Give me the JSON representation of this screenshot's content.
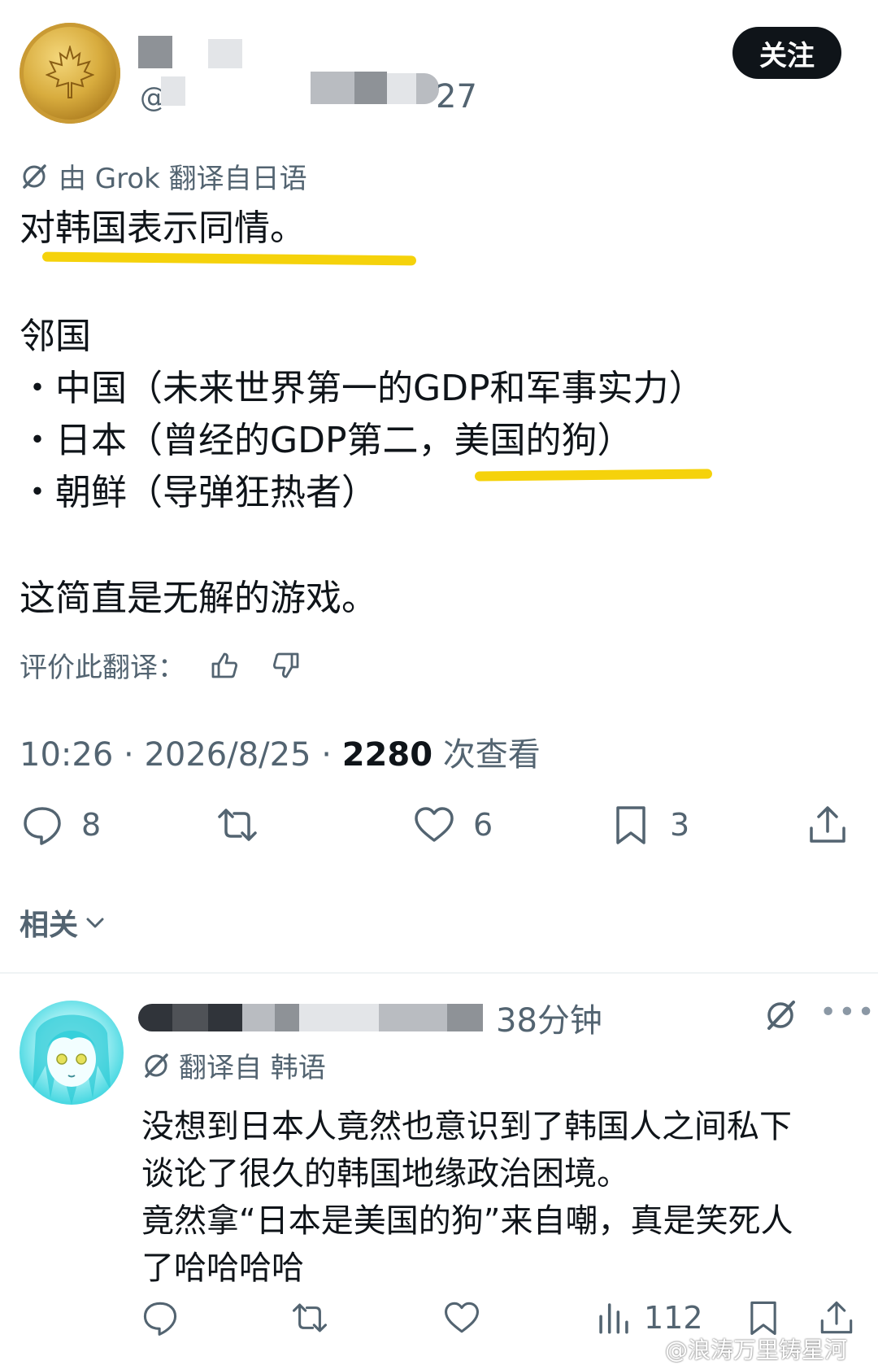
{
  "header": {
    "handle_prefix": "@",
    "handle_tail": "27",
    "follow_label": "关注"
  },
  "translation": {
    "label": "由 Grok 翻译自日语"
  },
  "post": {
    "line1": "对韩国表示同情。",
    "line2": "邻国",
    "bullet1": "・中国（未来世界第一的GDP和军事实力）",
    "bullet2": "・日本（曾经的GDP第二，美国的狗）",
    "bullet3": "・朝鲜（导弹狂热者）",
    "line3": "这简直是无解的游戏。"
  },
  "rate": {
    "label": "评价此翻译："
  },
  "meta": {
    "time": "10:26",
    "date": "2026/8/25",
    "views": "2280",
    "views_label": "次查看"
  },
  "actions": {
    "replies": "8",
    "likes": "6",
    "bookmarks": "3"
  },
  "related": {
    "label": "相关"
  },
  "reply": {
    "time": "38分钟",
    "translation_label": "翻译自 韩语",
    "line1": "没想到日本人竟然也意识到了韩国人之间私下",
    "line2": "谈论了很久的韩国地缘政治困境。",
    "line3": "竟然拿“日本是美国的狗”来自嘲，真是笑死人",
    "line4": "了哈哈哈哈",
    "views": "112"
  },
  "watermark": "@浪涛万里铸星河",
  "colors": {
    "highlight": "#f5d20b",
    "muted": "#536471",
    "text": "#0f1419"
  }
}
